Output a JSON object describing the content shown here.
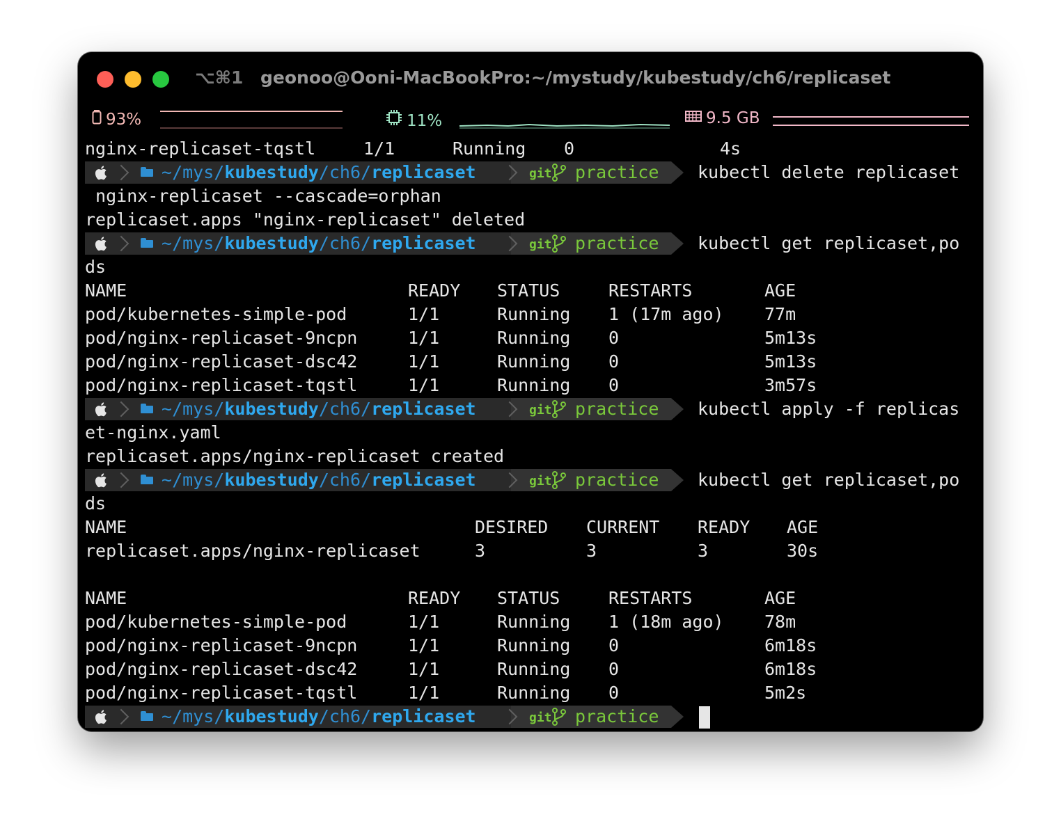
{
  "window": {
    "shortcut": "⌥⌘1",
    "title": "geonoo@Ooni-MacBookPro:~/mystudy/kubestudy/ch6/replicaset"
  },
  "status": {
    "battery": "93%",
    "cpu": "11%",
    "memory": "9.5 GB",
    "battery_icon": "battery-icon",
    "cpu_icon": "cpu-chip-icon",
    "memory_icon": "memory-icon"
  },
  "prompt": {
    "path_home": "~",
    "path_sep": "/",
    "path_mys": "mys",
    "path_kubestudy": "kubestudy",
    "path_ch6": "ch6",
    "path_replicaset": "replicaset",
    "git": "git",
    "branch": "practice"
  },
  "lines": {
    "l0": [
      "nginx-replicaset-tqstl",
      "1/1",
      "Running",
      "0",
      "4s"
    ],
    "cmd1": "kubectl delete replicaset",
    "cmd1_cont": " nginx-replicaset --cascade=orphan",
    "out1": "replicaset.apps \"nginx-replicaset\" deleted",
    "cmd2": "kubectl get replicaset,po",
    "cmd2_cont": "ds",
    "pods_header": [
      "NAME",
      "READY",
      "STATUS",
      "RESTARTS",
      "AGE"
    ],
    "pods1": [
      [
        "pod/kubernetes-simple-pod",
        "1/1",
        "Running",
        "1 (17m ago)",
        "77m"
      ],
      [
        "pod/nginx-replicaset-9ncpn",
        "1/1",
        "Running",
        "0",
        "5m13s"
      ],
      [
        "pod/nginx-replicaset-dsc42",
        "1/1",
        "Running",
        "0",
        "5m13s"
      ],
      [
        "pod/nginx-replicaset-tqstl",
        "1/1",
        "Running",
        "0",
        "3m57s"
      ]
    ],
    "cmd3": "kubectl apply -f replicas",
    "cmd3_cont": "et-nginx.yaml",
    "out3": "replicaset.apps/nginx-replicaset created",
    "cmd4": "kubectl get replicaset,po",
    "cmd4_cont": "ds",
    "rs_header": [
      "NAME",
      "DESIRED",
      "CURRENT",
      "READY",
      "AGE"
    ],
    "rs_row": [
      "replicaset.apps/nginx-replicaset",
      "3",
      "3",
      "3",
      "30s"
    ],
    "pods2": [
      [
        "pod/kubernetes-simple-pod",
        "1/1",
        "Running",
        "1 (18m ago)",
        "78m"
      ],
      [
        "pod/nginx-replicaset-9ncpn",
        "1/1",
        "Running",
        "0",
        "6m18s"
      ],
      [
        "pod/nginx-replicaset-dsc42",
        "1/1",
        "Running",
        "0",
        "6m18s"
      ],
      [
        "pod/nginx-replicaset-tqstl",
        "1/1",
        "Running",
        "0",
        "5m2s"
      ]
    ]
  },
  "colors": {
    "background": "#000000",
    "prompt_path": "#2f8fd3",
    "prompt_branch": "#7ac83b",
    "text": "#e6e6e6"
  }
}
